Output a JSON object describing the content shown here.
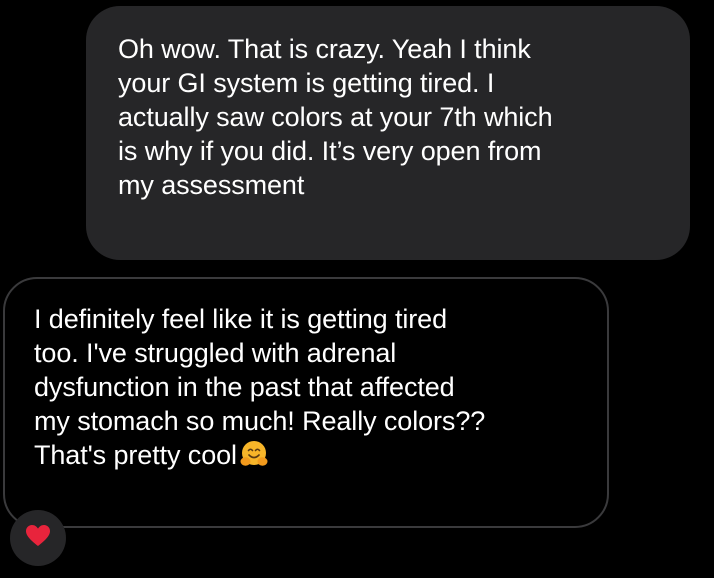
{
  "messages": [
    {
      "direction": "received",
      "lines": [
        "Oh wow. That is crazy. Yeah I think",
        "your GI system is getting tired. I",
        "actually saw colors at your 7th which",
        "is why if you did. It’s very open from",
        "my assessment"
      ]
    },
    {
      "direction": "sent",
      "lines": [
        "I definitely feel like it is getting tired",
        "too. I've struggled with adrenal",
        "dysfunction in the past that affected",
        "my stomach so much! Really colors??",
        "That's pretty cool"
      ],
      "trailing_emoji": "hugging-face-icon",
      "reaction": "heart-icon"
    }
  ],
  "colors": {
    "background": "#000000",
    "received_bubble": "#262628",
    "sent_bubble_border": "#3a3a3c",
    "text": "#ffffff",
    "reaction_heart": "#e8243c",
    "emoji_face": "#f7b529"
  }
}
